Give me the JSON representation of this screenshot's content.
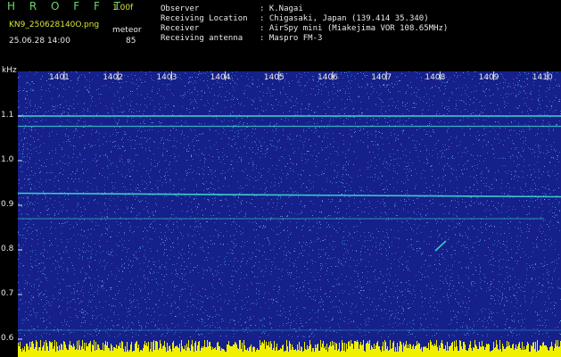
{
  "header": {
    "brand": "H R O F F T",
    "version": "1.00f",
    "filename": "KN9_250628140O.png",
    "datetime": "25.06.28 14:00",
    "meteor_label": "meteor",
    "meteor_count": "85",
    "fields": [
      {
        "key": "Observer",
        "value": ": K.Nagai"
      },
      {
        "key": "Receiving Location",
        "value": ": Chigasaki, Japan (139.414 35.340)"
      },
      {
        "key": "Receiver",
        "value": ": AirSpy mini (Miakejima VOR 108.65MHz)"
      },
      {
        "key": "Receiving antenna",
        "value": ": Maspro FM-3"
      }
    ]
  },
  "spectrogram": {
    "y_unit": "kHz",
    "y_ticks": [
      "1.1",
      "1.0",
      "0.9",
      "0.8",
      "0.7",
      "0.6"
    ],
    "x_ticks": [
      "1401",
      "1402",
      "1403",
      "1404",
      "1405",
      "1406",
      "1407",
      "1408",
      "1409",
      "1410"
    ],
    "colors": {
      "background": "#16208a",
      "noise": "#3c78e0",
      "line": "#3de0d0",
      "bottom_noise": "#f0f000"
    }
  }
}
